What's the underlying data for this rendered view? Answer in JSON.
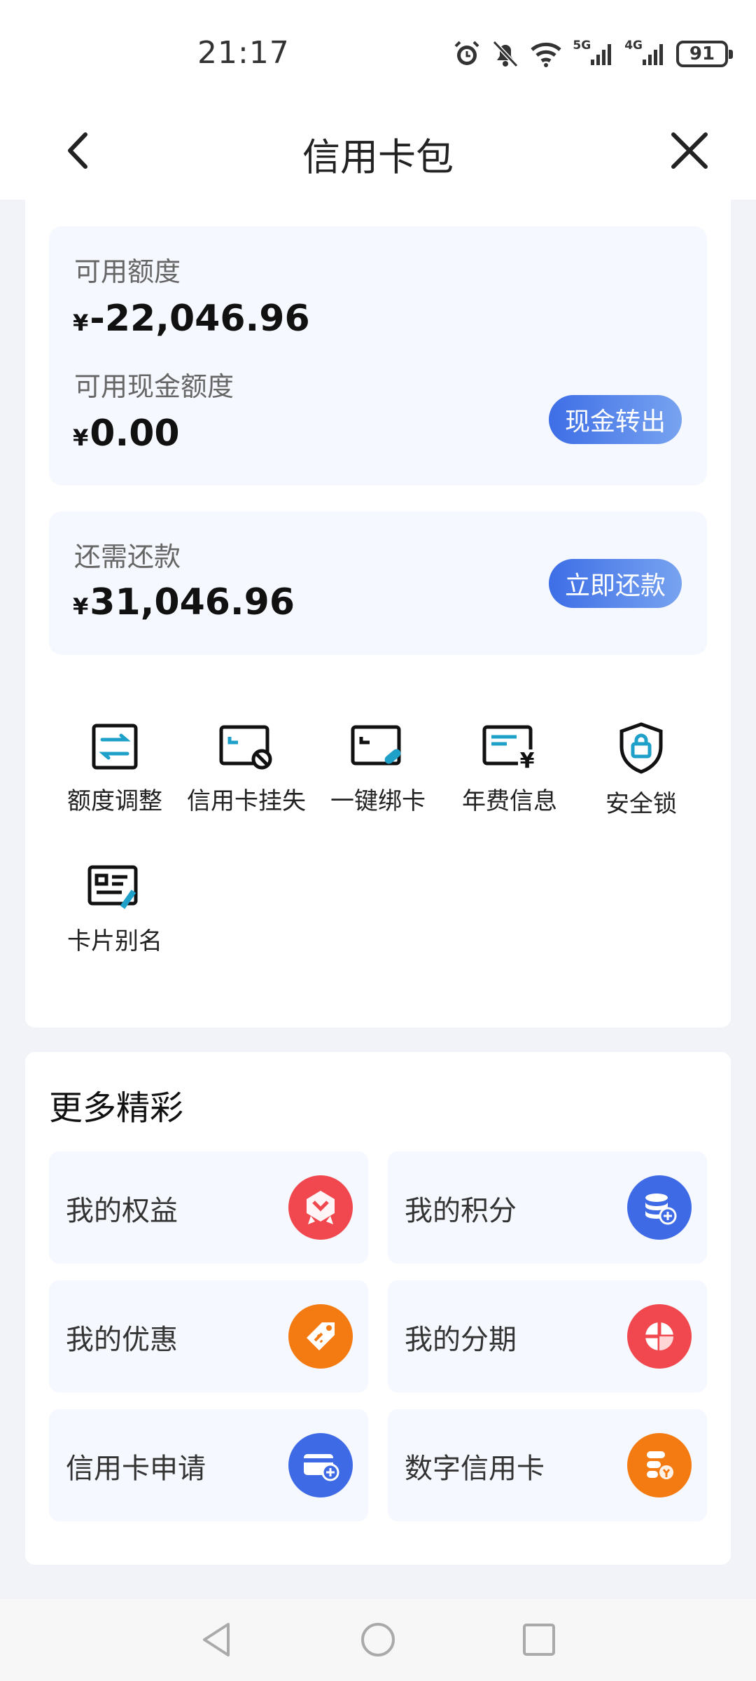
{
  "status_bar": {
    "time": "21:17",
    "network_1": "5G",
    "network_2": "4G",
    "battery": "91",
    "icons": [
      "alarm-icon",
      "mute-icon",
      "wifi-icon",
      "signal-icon",
      "signal-icon",
      "battery-icon"
    ]
  },
  "nav": {
    "title": "信用卡包",
    "back_icon": "chevron-left-icon",
    "close_icon": "close-icon"
  },
  "account": {
    "available_limit_label": "可用额度",
    "available_limit_currency": "¥",
    "available_limit_value": "-22,046.96",
    "cash_limit_label": "可用现金额度",
    "cash_limit_currency": "¥",
    "cash_limit_value": "0.00",
    "cash_out_button": "现金转出",
    "repay_label": "还需还款",
    "repay_currency": "¥",
    "repay_value": "31,046.96",
    "repay_button": "立即还款"
  },
  "functions": [
    {
      "label": "额度调整",
      "icon": "limit-adjust-icon"
    },
    {
      "label": "信用卡挂失",
      "icon": "card-lost-icon"
    },
    {
      "label": "一键绑卡",
      "icon": "bind-card-icon"
    },
    {
      "label": "年费信息",
      "icon": "annual-fee-icon"
    },
    {
      "label": "安全锁",
      "icon": "security-lock-icon"
    },
    {
      "label": "卡片别名",
      "icon": "card-alias-icon"
    }
  ],
  "more": {
    "title": "更多精彩",
    "tiles": [
      {
        "label": "我的权益",
        "icon": "rights-icon",
        "color": "#f0484e"
      },
      {
        "label": "我的积分",
        "icon": "points-icon",
        "color": "#3f6ae6"
      },
      {
        "label": "我的优惠",
        "icon": "discount-icon",
        "color": "#f47a12"
      },
      {
        "label": "我的分期",
        "icon": "installment-icon",
        "color": "#f0484e"
      },
      {
        "label": "信用卡申请",
        "icon": "card-apply-icon",
        "color": "#3f6ae6"
      },
      {
        "label": "数字信用卡",
        "icon": "digital-card-icon",
        "color": "#f47a12"
      }
    ]
  },
  "colors": {
    "accent": "#3d6ee6",
    "icon_blue": "#1ea0c8",
    "panel_bg": "#f5f8fe"
  }
}
